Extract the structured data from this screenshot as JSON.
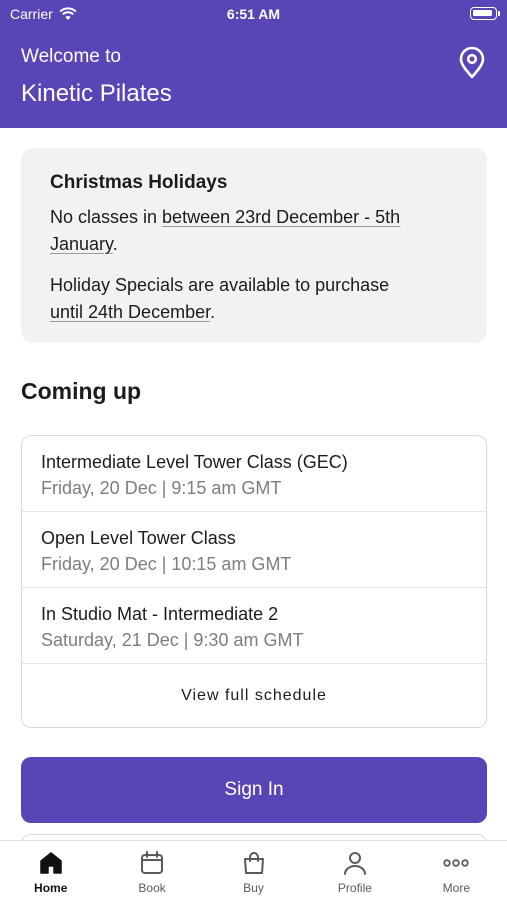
{
  "status_bar": {
    "carrier": "Carrier",
    "time": "6:51 AM"
  },
  "header": {
    "welcome": "Welcome to",
    "studio_name": "Kinetic Pilates",
    "location_icon": "location-pin-icon"
  },
  "notice": {
    "title": "Christmas Holidays",
    "line1_prefix": "No classes in ",
    "line1_link_a": "between 23rd December - 5th",
    "line1_link_b": "January",
    "line1_suffix": ".",
    "line2_prefix": "Holiday Specials are available to purchase ",
    "line2_link": "until 24th December",
    "line2_suffix": "."
  },
  "coming_up": {
    "heading": "Coming up",
    "classes": [
      {
        "name": "Intermediate Level Tower Class (GEC)",
        "time": "Friday, 20 Dec | 9:15 am GMT"
      },
      {
        "name": "Open Level Tower Class",
        "time": "Friday, 20 Dec | 10:15 am GMT"
      },
      {
        "name": "In Studio Mat - Intermediate 2",
        "time": "Saturday, 21 Dec | 9:30 am GMT"
      }
    ],
    "view_full_schedule": "View full schedule"
  },
  "sign_in_label": "Sign In",
  "tabs": [
    {
      "label": "Home",
      "icon": "home-icon",
      "active": true
    },
    {
      "label": "Book",
      "icon": "calendar-icon",
      "active": false
    },
    {
      "label": "Buy",
      "icon": "shopping-bag-icon",
      "active": false
    },
    {
      "label": "Profile",
      "icon": "person-icon",
      "active": false
    },
    {
      "label": "More",
      "icon": "more-dots-icon",
      "active": false
    }
  ],
  "colors": {
    "brand": "#5945b5",
    "card_bg": "#f2f2f4",
    "muted_text": "#7d7d82"
  }
}
